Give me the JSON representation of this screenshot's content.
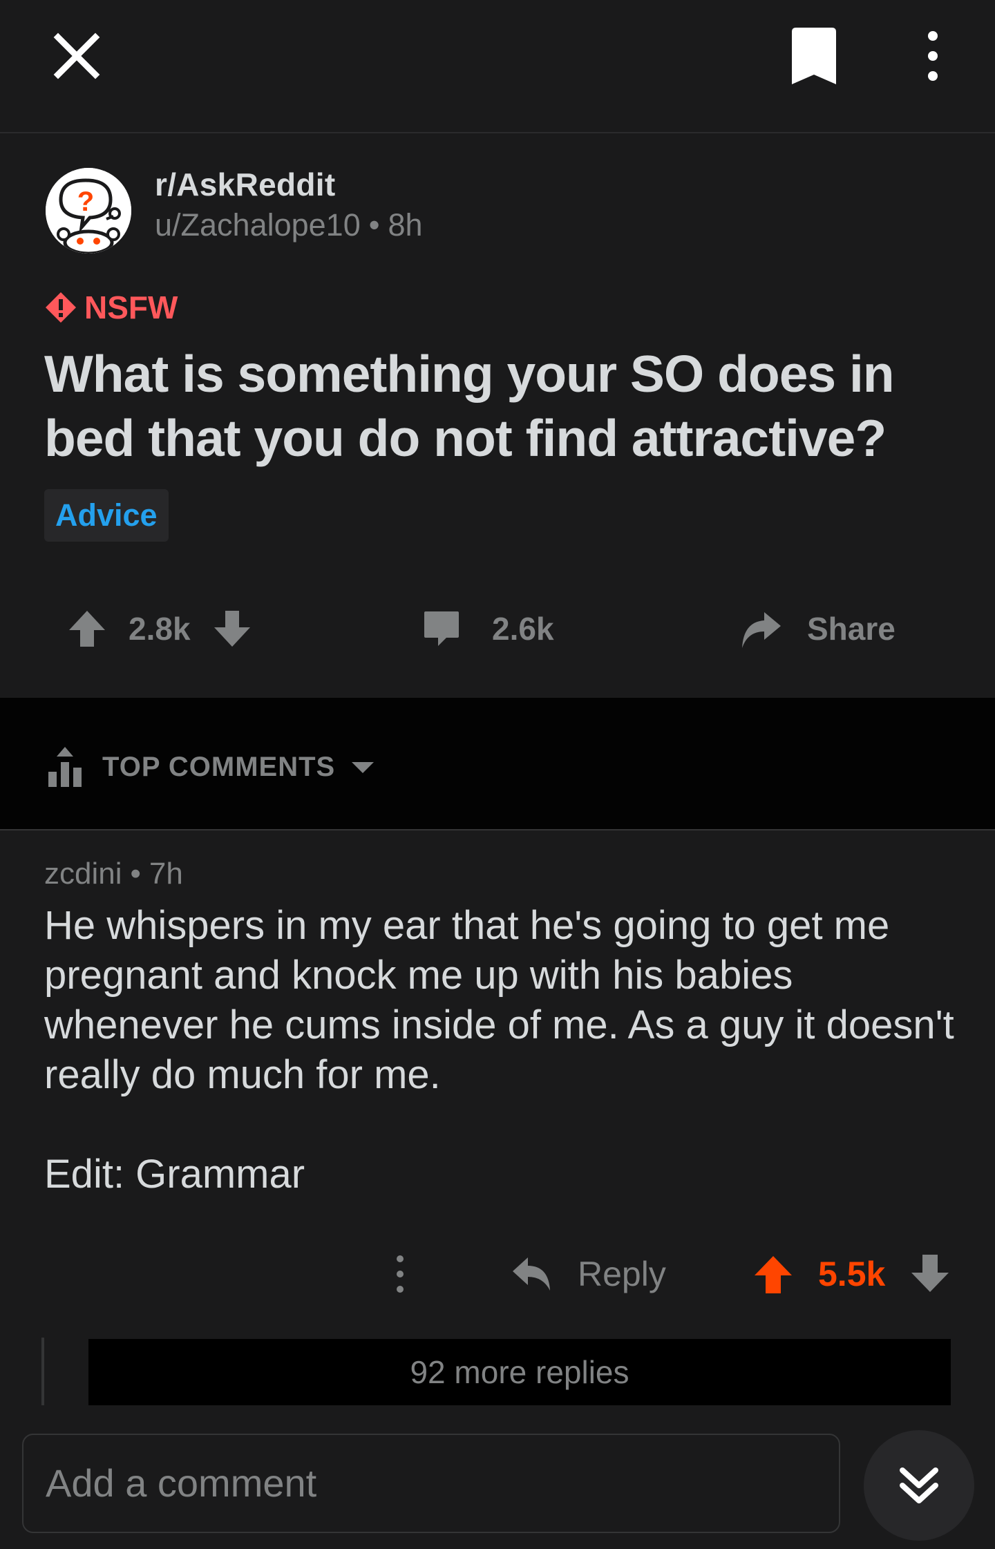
{
  "topbar": {
    "close_icon": "close-icon",
    "save_icon": "bookmark-icon",
    "more_icon": "more-vertical-icon"
  },
  "post": {
    "subreddit": "r/AskReddit",
    "author": "u/Zachalope10",
    "age": "8h",
    "nsfw_label": "NSFW",
    "title": "What is something your SO does in bed that you do not find attractive?",
    "flair": "Advice",
    "score": "2.8k",
    "comment_count": "2.6k",
    "share_label": "Share"
  },
  "sort": {
    "label": "TOP COMMENTS"
  },
  "comment": {
    "author": "zcdini",
    "age": "7h",
    "body": "He whispers in my ear that he's going to get me pregnant and knock me up with his babies whenever he cums inside of me. As a guy it doesn't really do much for me.",
    "edit": "Edit: Grammar",
    "reply_label": "Reply",
    "score": "5.5k",
    "more_replies": "92 more replies"
  },
  "composer": {
    "placeholder": "Add a comment"
  },
  "colors": {
    "background": "#1a1a1b",
    "text": "#d7dadc",
    "muted": "#818384",
    "nsfw": "#ff585b",
    "flair": "#24a0ed",
    "upvote": "#ff4500"
  }
}
